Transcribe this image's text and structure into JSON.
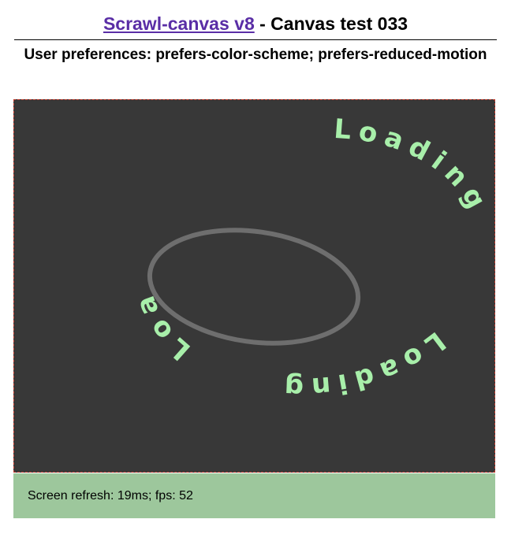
{
  "header": {
    "link_text": "Scrawl-canvas v8",
    "title_suffix": " - Canvas test 033"
  },
  "subtitle": "User preferences: prefers-color-scheme; prefers-reduced-motion",
  "canvas": {
    "background_color": "#383838",
    "ellipse_color": "#6e6e6e",
    "text_color": "#a8efaa",
    "loading_labels": [
      "Loading",
      "Loading",
      "Loading"
    ]
  },
  "status": {
    "text": "Screen refresh: 19ms; fps: 52",
    "background_color": "#9dc79c"
  }
}
